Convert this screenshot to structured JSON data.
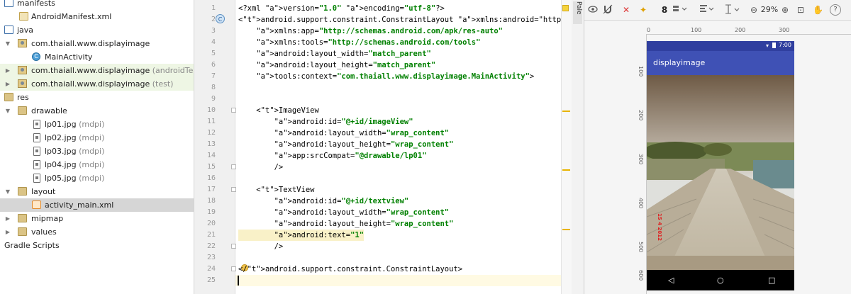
{
  "project_tree": {
    "items": [
      {
        "label": "manifests",
        "sub": ""
      },
      {
        "label": "AndroidManifest.xml",
        "sub": ""
      },
      {
        "label": "java",
        "sub": ""
      },
      {
        "label": "com.thaiall.www.displayimage",
        "sub": ""
      },
      {
        "label": "MainActivity",
        "sub": ""
      },
      {
        "label": "com.thaiall.www.displayimage",
        "sub": "(androidTest)"
      },
      {
        "label": "com.thaiall.www.displayimage",
        "sub": "(test)"
      },
      {
        "label": "res",
        "sub": ""
      },
      {
        "label": "drawable",
        "sub": ""
      },
      {
        "label": "lp01.jpg",
        "sub": "(mdpi)"
      },
      {
        "label": "lp02.jpg",
        "sub": "(mdpi)"
      },
      {
        "label": "lp03.jpg",
        "sub": "(mdpi)"
      },
      {
        "label": "lp04.jpg",
        "sub": "(mdpi)"
      },
      {
        "label": "lp05.jpg",
        "sub": "(mdpi)"
      },
      {
        "label": "layout",
        "sub": ""
      },
      {
        "label": "activity_main.xml",
        "sub": ""
      },
      {
        "label": "mipmap",
        "sub": ""
      },
      {
        "label": "values",
        "sub": ""
      },
      {
        "label": "Gradle Scripts",
        "sub": ""
      }
    ]
  },
  "editor": {
    "line_numbers": [
      "1",
      "2",
      "3",
      "4",
      "5",
      "6",
      "7",
      "8",
      "9",
      "10",
      "11",
      "12",
      "13",
      "14",
      "15",
      "16",
      "17",
      "18",
      "19",
      "20",
      "21",
      "22",
      "23",
      "24",
      "25"
    ],
    "gutter_class_marker": "C",
    "lines": [
      "<?xml version=\"1.0\" encoding=\"utf-8\"?>",
      "<android.support.constraint.ConstraintLayout xmlns:android=\"http://sche",
      "    xmlns:app=\"http://schemas.android.com/apk/res-auto\"",
      "    xmlns:tools=\"http://schemas.android.com/tools\"",
      "    android:layout_width=\"match_parent\"",
      "    android:layout_height=\"match_parent\"",
      "    tools:context=\"com.thaiall.www.displayimage.MainActivity\">",
      "",
      "",
      "    <ImageView",
      "        android:id=\"@+id/imageView\"",
      "        android:layout_width=\"wrap_content\"",
      "        android:layout_height=\"wrap_content\"",
      "        app:srcCompat=\"@drawable/lp01\"",
      "        />",
      "",
      "    <TextView",
      "        android:id=\"@+id/textview\"",
      "        android:layout_width=\"wrap_content\"",
      "        android:layout_height=\"wrap_content\"",
      "        android:text=\"1\"",
      "        />",
      "",
      "</android.support.constraint.ConstraintLayout>",
      ""
    ]
  },
  "palette": {
    "label": "Pale"
  },
  "design_toolbar": {
    "eye_icon": "eye-icon",
    "magnet_icon": "magnet-icon",
    "clear_constraints": "✕",
    "infer_constraints": "✦",
    "margin": "8",
    "zoom_out": "⊖",
    "zoom_level": "29%",
    "zoom_in": "⊕",
    "fit": "⊡",
    "pan": "✋",
    "help": "?"
  },
  "rulers": {
    "horizontal": [
      "0",
      "100",
      "200",
      "300"
    ],
    "vertical": [
      "100",
      "200",
      "300",
      "400",
      "500",
      "600"
    ]
  },
  "device_preview": {
    "status_time": "7:00",
    "app_title": "displayimage",
    "photo_date_stamp": "15 4 2012",
    "nav_back": "◁",
    "nav_home": "○",
    "nav_recent": "□"
  },
  "colors": {
    "status_bar": "#303f9f",
    "app_bar": "#3f51b5",
    "tree_green_row": "#eef6e4",
    "tree_selected_row": "#d6d6d6"
  }
}
